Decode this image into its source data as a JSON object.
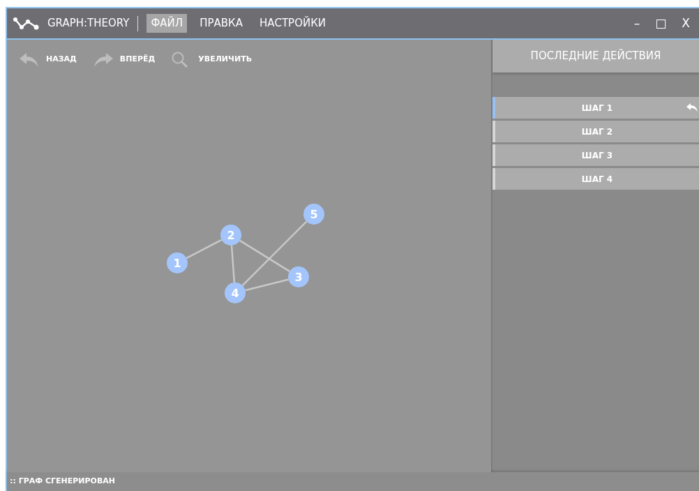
{
  "window": {
    "app_name": "GRAPH:THEORY",
    "controls": [
      "–",
      "□",
      "X"
    ]
  },
  "menu": [
    {
      "label": "ФАЙЛ",
      "selected": true
    },
    {
      "label": "ПРАВКА",
      "selected": false
    },
    {
      "label": "НАСТРОЙКИ",
      "selected": false
    }
  ],
  "toolbar": [
    {
      "kind": "back",
      "label": "НАЗАД"
    },
    {
      "kind": "forward",
      "label": "ВПЕРЁД"
    },
    {
      "kind": "zoom",
      "label": "УВЕЛИЧИТЬ"
    }
  ],
  "graph": {
    "nodes": [
      "1",
      "2",
      "3",
      "4",
      "5"
    ]
  },
  "history": {
    "title": "ПОСЛЕДНИЕ ДЕЙСТВИЯ",
    "steps": [
      {
        "label": "ШАГ 1",
        "selected": true
      },
      {
        "label": "ШАГ 2",
        "selected": false
      },
      {
        "label": "ШАГ 3",
        "selected": false
      },
      {
        "label": "ШАГ 4",
        "selected": false
      }
    ]
  },
  "status_bar": ":: ГРАФ СГЕНЕРИРОВАН"
}
